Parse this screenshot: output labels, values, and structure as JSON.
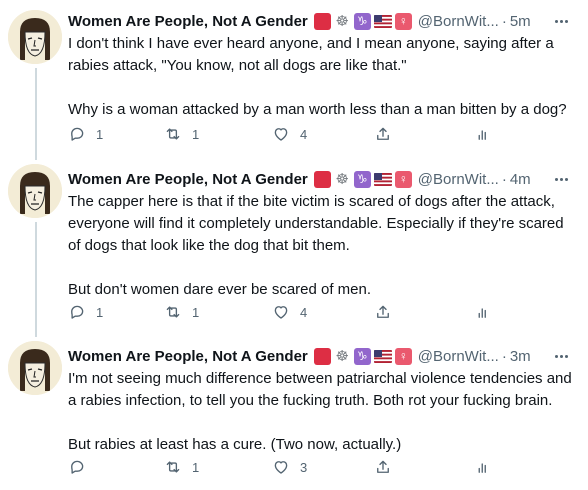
{
  "tweets": [
    {
      "display_name": "Women Are People, Not A Gender",
      "handle": "@BornWit...",
      "dot": "·",
      "time": "5m",
      "paragraphs": [
        "I don't think I have ever heard anyone, and I mean anyone, saying after a\nrabies attack, \"You know, not all dogs are like that.\"",
        "Why is a woman attacked by a man worth less than a man bitten by a dog?"
      ],
      "replies": "1",
      "retweets": "1",
      "likes": "4"
    },
    {
      "display_name": "Women Are People, Not A Gender",
      "handle": "@BornWit...",
      "dot": "·",
      "time": "4m",
      "paragraphs": [
        "The capper here is that if the bite victim is scared of dogs after the attack,\neveryone will find it completely understandable. Especially if they're scared\nof dogs that look like the dog that bit them.",
        "But don't women dare ever be scared of men."
      ],
      "replies": "1",
      "retweets": "1",
      "likes": "4"
    },
    {
      "display_name": "Women Are People, Not A Gender",
      "handle": "@BornWit...",
      "dot": "·",
      "time": "3m",
      "paragraphs": [
        "I'm not seeing much difference between patriarchal violence tendencies and\na rabies infection, to tell you the fucking truth. Both rot your fucking brain.",
        "But rabies at least has a cure. (Two now, actually.)"
      ],
      "replies": "",
      "retweets": "1",
      "likes": "3"
    }
  ],
  "badges": {
    "square": "red-square-icon",
    "wheel": "dharma-wheel-icon",
    "capricorn": "♑",
    "flag": "us-flag-icon",
    "venus": "♀"
  },
  "colors": {
    "text": "#0f1419",
    "muted": "#536471",
    "thread_line": "#cfd9de",
    "red_badge": "#dd2e44",
    "purple_badge": "#9266cc",
    "pink_badge": "#ea596e"
  }
}
